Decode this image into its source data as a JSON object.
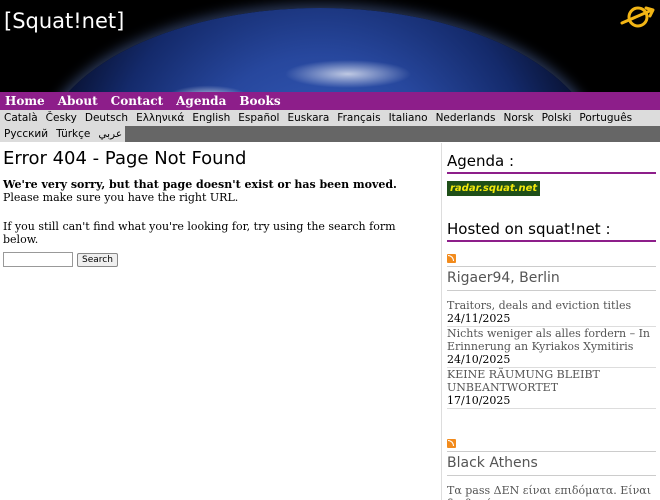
{
  "header": {
    "site_title": "[Squat!net]",
    "logo_icon": "squat-symbol-icon"
  },
  "nav": {
    "items": [
      "Home",
      "About",
      "Contact",
      "Agenda",
      "Books"
    ]
  },
  "languages": {
    "row1": [
      "Català",
      "Česky",
      "Deutsch",
      "Ελληνικά",
      "English",
      "Español",
      "Euskara",
      "Français",
      "Italiano",
      "Nederlands",
      "Norsk",
      "Polski",
      "Português"
    ],
    "row2": [
      "Русский",
      "Türkçe",
      "عربي"
    ]
  },
  "content": {
    "title": "Error 404 - Page Not Found",
    "sorry": "We're very sorry, but that page doesn't exist or has been moved.",
    "check_url": "Please make sure you have the right URL.",
    "search_hint": "If you still can't find what you're looking for, try using the search form below.",
    "search_button": "Search",
    "search_value": ""
  },
  "sidebar": {
    "agenda_heading": "Agenda :",
    "radar_label": "radar.squat.net",
    "hosted_heading": "Hosted on squat!net :",
    "feeds": [
      {
        "title": "Rigaer94, Berlin",
        "items": [
          {
            "title": "Traitors, deals and eviction titles",
            "date": "24/11/2025"
          },
          {
            "title": "Nichts weniger als alles fordern – In Erinnerung an Kyriakos Xymitiris",
            "date": "24/10/2025"
          },
          {
            "title": "KEINE RÄUMUNG BLEIBT UNBEANTWORTET",
            "date": "17/10/2025"
          }
        ]
      },
      {
        "title": "Black Athens",
        "items": [
          {
            "title": "Τα pass ΔΕΝ είναι επιδόματα. Είναι διαβατήρια."
          }
        ]
      }
    ]
  },
  "colors": {
    "nav_bg": "#8d1e8a",
    "lang_bg": "#dcdcdc",
    "radar_bg": "#1f4f18",
    "radar_fg": "#f1e70c",
    "logo": "#f2b515"
  }
}
